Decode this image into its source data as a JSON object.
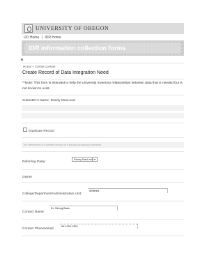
{
  "header": {
    "university": "UNIVERSITY OF OREGON",
    "breadcrumb": [
      "UO Home",
      "|",
      "IDR Home"
    ],
    "banner_title": "IDR information collection forms"
  },
  "form": {
    "breadcrumb": "Home » Create content",
    "title": "Create Record of Data Integration Need",
    "note": "**Note: This form is intended to help the university inventory relationships between data that is needed but is not known to exist.",
    "submitter": "Submitter's Name: Randy MacLeod",
    "duplicate_label": "Duplicate Record",
    "helper_text": "The referenced or is needed version of a record's previously submitted.",
    "referring_party_label": "Referring Party:",
    "referring_party_value": "Randy MacLeod",
    "owner_label": "Owner",
    "college_label": "College/Department/Administrative Unit:",
    "college_value": "Athletics",
    "contact_name_label": "Contact Name:",
    "contact_name_value": "Dr. Strong Bass",
    "contact_phone_label": "Contact Phone/email:",
    "contact_phone_value": "541 990-1300"
  },
  "icons": {
    "logo": "uo-logo-icon",
    "select_arrow": "chevron-down-icon"
  }
}
